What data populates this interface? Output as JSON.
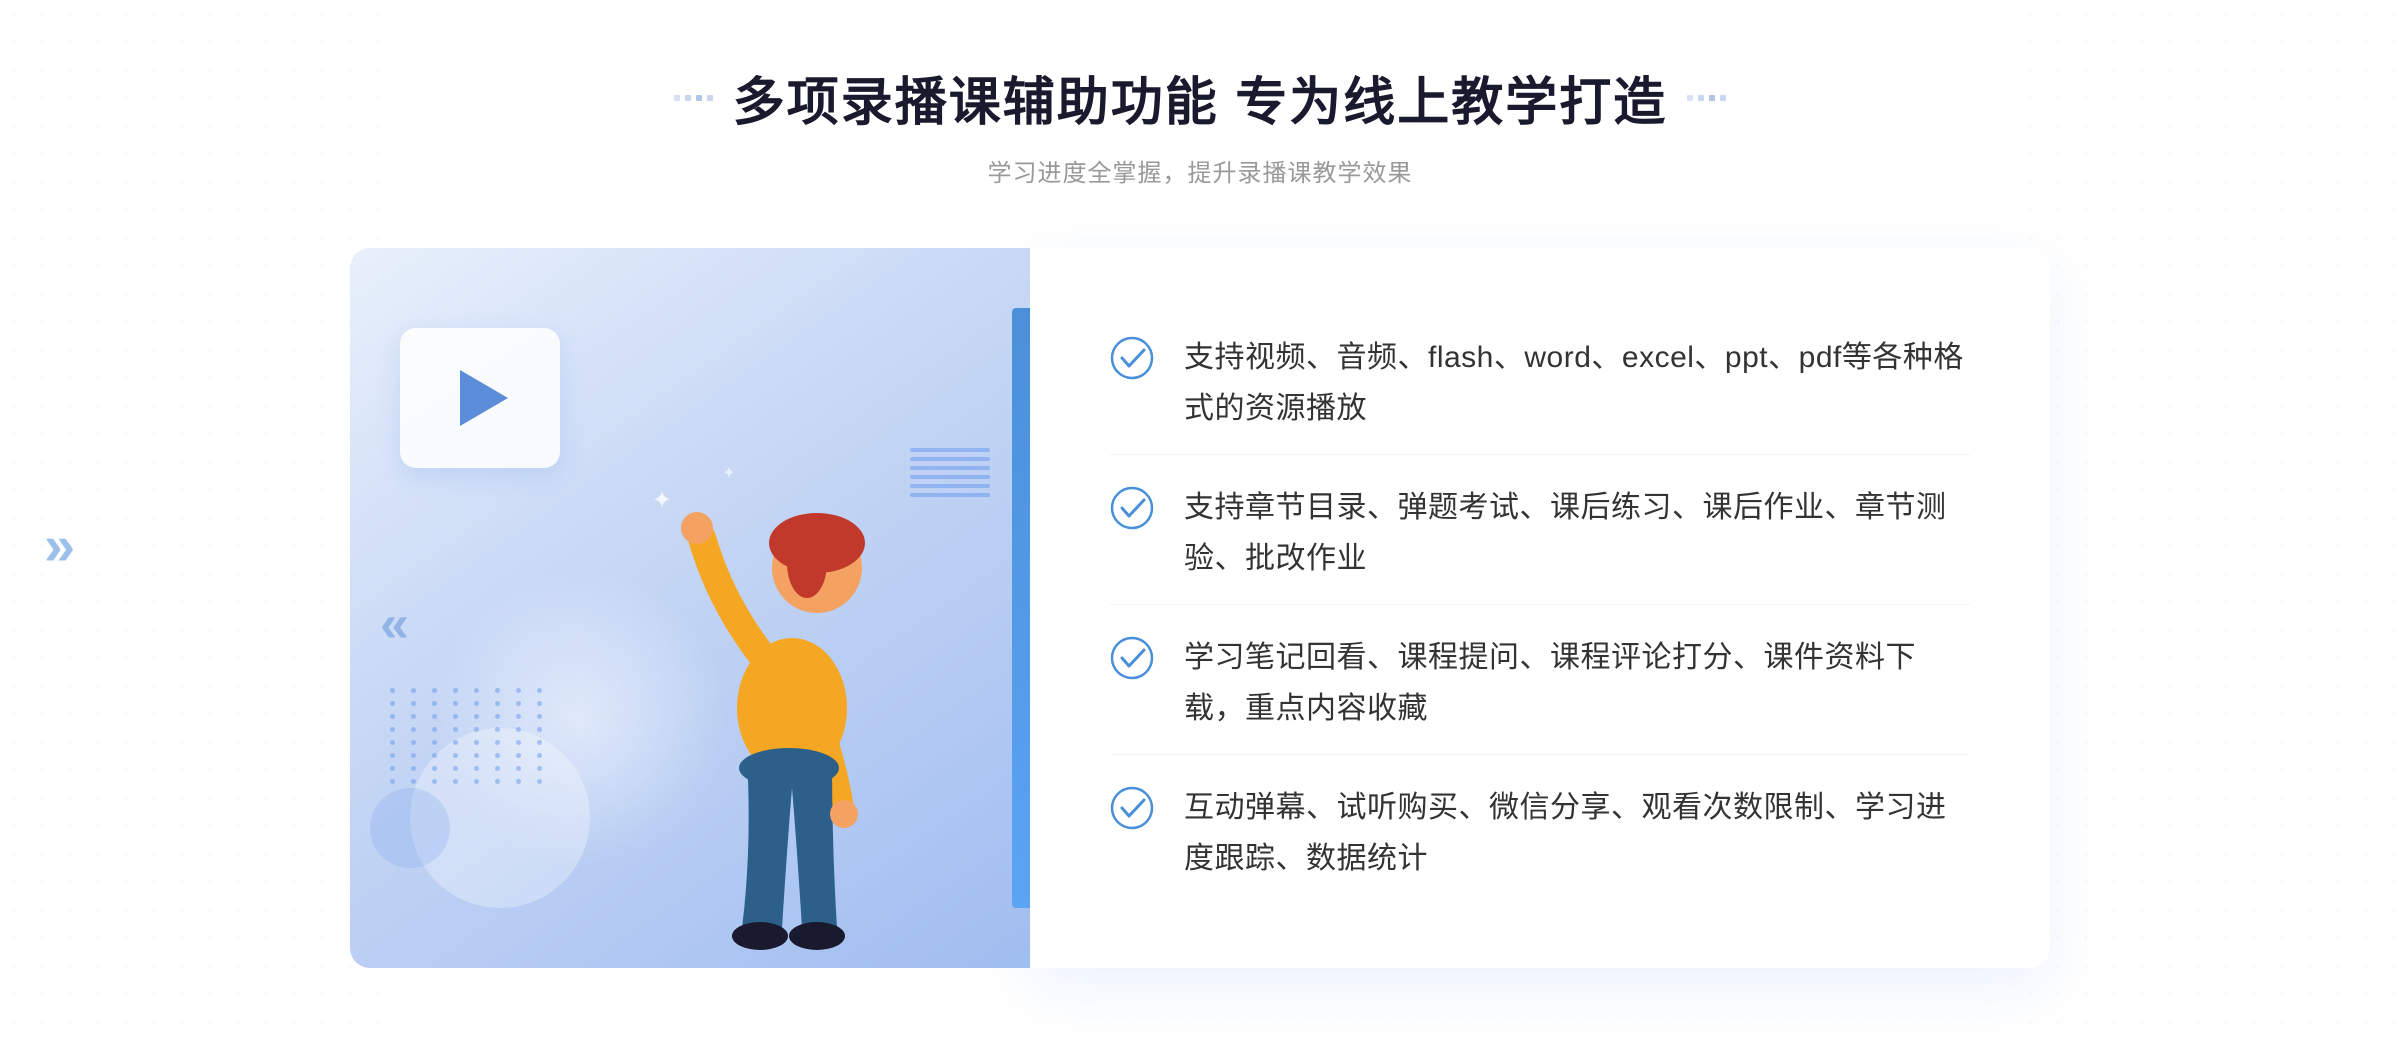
{
  "header": {
    "title": "多项录播课辅助功能 专为线上教学打造",
    "subtitle": "学习进度全掌握，提升录播课教学效果",
    "title_decorator_left": "◆◆◆◆",
    "title_decorator_right": "◆◆◆◆"
  },
  "features": [
    {
      "id": 1,
      "text": "支持视频、音频、flash、word、excel、ppt、pdf等各种格式的资源播放"
    },
    {
      "id": 2,
      "text": "支持章节目录、弹题考试、课后练习、课后作业、章节测验、批改作业"
    },
    {
      "id": 3,
      "text": "学习笔记回看、课程提问、课程评论打分、课件资料下载，重点内容收藏"
    },
    {
      "id": 4,
      "text": "互动弹幕、试听购买、微信分享、观看次数限制、学习进度跟踪、数据统计"
    }
  ],
  "colors": {
    "primary": "#4a90d9",
    "light_blue": "#a0bdf0",
    "text_dark": "#1a1a2e",
    "text_gray": "#999999",
    "text_body": "#333333",
    "bg_white": "#ffffff",
    "check_color": "#4a90d9"
  },
  "icons": {
    "check": "check-circle",
    "play": "play-triangle",
    "chevron_left": "«",
    "chevron_right": "»"
  }
}
